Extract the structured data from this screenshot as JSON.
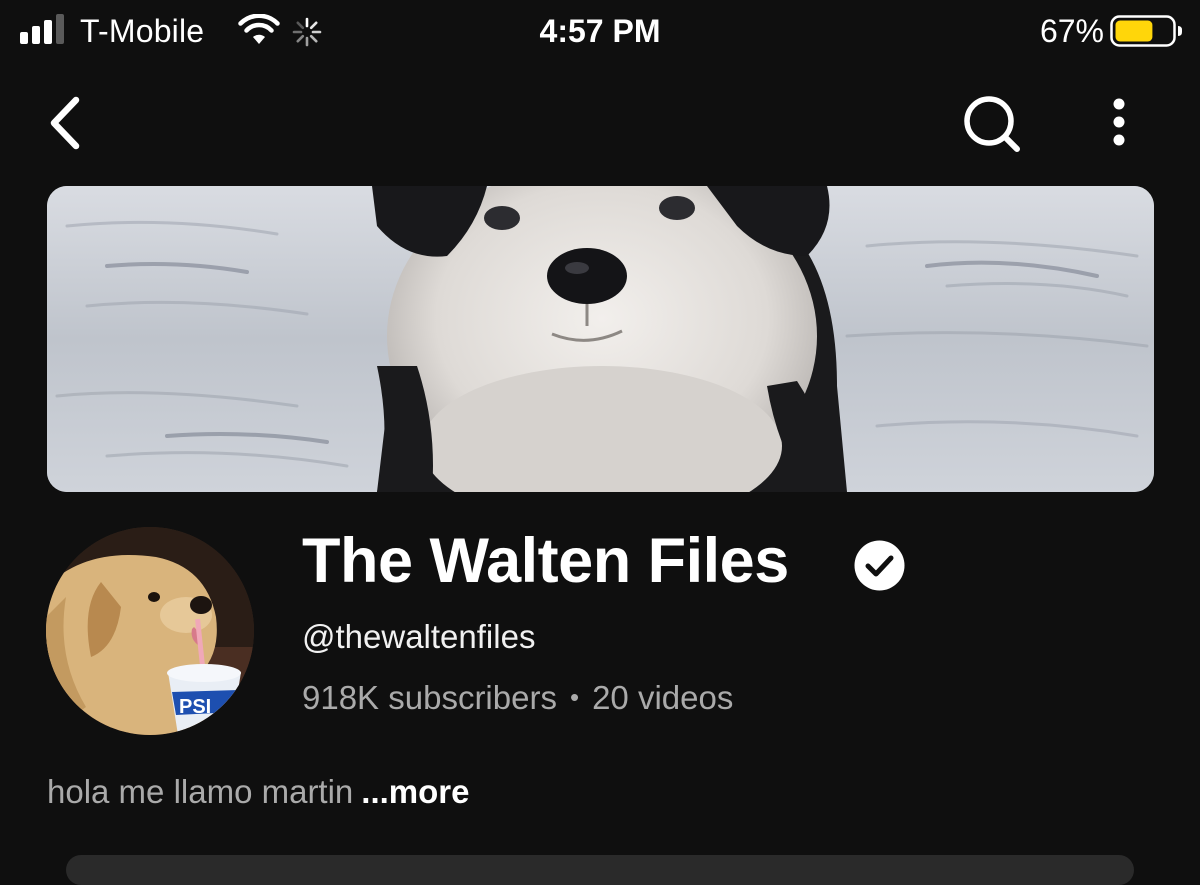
{
  "status_bar": {
    "carrier": "T-Mobile",
    "time": "4:57 PM",
    "battery_percent": "67%",
    "battery_level": 0.67,
    "battery_color": "#ffd60a",
    "signal_bars_active": 3,
    "signal_bars_total": 4,
    "icons": [
      "signal-icon",
      "wifi-icon",
      "loading-icon",
      "battery-icon"
    ]
  },
  "nav": {
    "icons": [
      "back-chevron-icon",
      "search-icon",
      "more-vertical-icon"
    ]
  },
  "channel": {
    "title": "The Walten Files",
    "handle": "@thewaltenfiles",
    "subscribers": "918K subscribers",
    "separator": "•",
    "videos": "20 videos",
    "description": "hola me llamo martin",
    "more_label": "...more",
    "verified_icon": "verified-check-icon",
    "avatar_cup_text": "PSI"
  },
  "colors": {
    "background": "#0f0f0f",
    "primary_text": "#ffffff",
    "secondary_text": "#aaaaaa",
    "verified_badge": "#ffffff"
  }
}
